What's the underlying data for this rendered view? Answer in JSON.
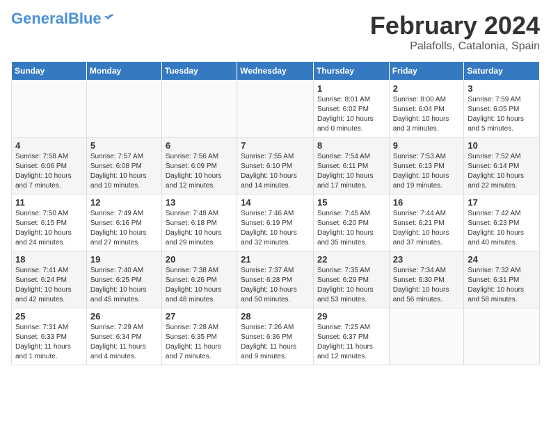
{
  "header": {
    "logo_general": "General",
    "logo_blue": "Blue",
    "month": "February 2024",
    "location": "Palafolls, Catalonia, Spain"
  },
  "weekdays": [
    "Sunday",
    "Monday",
    "Tuesday",
    "Wednesday",
    "Thursday",
    "Friday",
    "Saturday"
  ],
  "weeks": [
    [
      {
        "day": "",
        "info": ""
      },
      {
        "day": "",
        "info": ""
      },
      {
        "day": "",
        "info": ""
      },
      {
        "day": "",
        "info": ""
      },
      {
        "day": "1",
        "info": "Sunrise: 8:01 AM\nSunset: 6:02 PM\nDaylight: 10 hours and 0 minutes."
      },
      {
        "day": "2",
        "info": "Sunrise: 8:00 AM\nSunset: 6:04 PM\nDaylight: 10 hours and 3 minutes."
      },
      {
        "day": "3",
        "info": "Sunrise: 7:59 AM\nSunset: 6:05 PM\nDaylight: 10 hours and 5 minutes."
      }
    ],
    [
      {
        "day": "4",
        "info": "Sunrise: 7:58 AM\nSunset: 6:06 PM\nDaylight: 10 hours and 7 minutes."
      },
      {
        "day": "5",
        "info": "Sunrise: 7:57 AM\nSunset: 6:08 PM\nDaylight: 10 hours and 10 minutes."
      },
      {
        "day": "6",
        "info": "Sunrise: 7:56 AM\nSunset: 6:09 PM\nDaylight: 10 hours and 12 minutes."
      },
      {
        "day": "7",
        "info": "Sunrise: 7:55 AM\nSunset: 6:10 PM\nDaylight: 10 hours and 14 minutes."
      },
      {
        "day": "8",
        "info": "Sunrise: 7:54 AM\nSunset: 6:11 PM\nDaylight: 10 hours and 17 minutes."
      },
      {
        "day": "9",
        "info": "Sunrise: 7:53 AM\nSunset: 6:13 PM\nDaylight: 10 hours and 19 minutes."
      },
      {
        "day": "10",
        "info": "Sunrise: 7:52 AM\nSunset: 6:14 PM\nDaylight: 10 hours and 22 minutes."
      }
    ],
    [
      {
        "day": "11",
        "info": "Sunrise: 7:50 AM\nSunset: 6:15 PM\nDaylight: 10 hours and 24 minutes."
      },
      {
        "day": "12",
        "info": "Sunrise: 7:49 AM\nSunset: 6:16 PM\nDaylight: 10 hours and 27 minutes."
      },
      {
        "day": "13",
        "info": "Sunrise: 7:48 AM\nSunset: 6:18 PM\nDaylight: 10 hours and 29 minutes."
      },
      {
        "day": "14",
        "info": "Sunrise: 7:46 AM\nSunset: 6:19 PM\nDaylight: 10 hours and 32 minutes."
      },
      {
        "day": "15",
        "info": "Sunrise: 7:45 AM\nSunset: 6:20 PM\nDaylight: 10 hours and 35 minutes."
      },
      {
        "day": "16",
        "info": "Sunrise: 7:44 AM\nSunset: 6:21 PM\nDaylight: 10 hours and 37 minutes."
      },
      {
        "day": "17",
        "info": "Sunrise: 7:42 AM\nSunset: 6:23 PM\nDaylight: 10 hours and 40 minutes."
      }
    ],
    [
      {
        "day": "18",
        "info": "Sunrise: 7:41 AM\nSunset: 6:24 PM\nDaylight: 10 hours and 42 minutes."
      },
      {
        "day": "19",
        "info": "Sunrise: 7:40 AM\nSunset: 6:25 PM\nDaylight: 10 hours and 45 minutes."
      },
      {
        "day": "20",
        "info": "Sunrise: 7:38 AM\nSunset: 6:26 PM\nDaylight: 10 hours and 48 minutes."
      },
      {
        "day": "21",
        "info": "Sunrise: 7:37 AM\nSunset: 6:28 PM\nDaylight: 10 hours and 50 minutes."
      },
      {
        "day": "22",
        "info": "Sunrise: 7:35 AM\nSunset: 6:29 PM\nDaylight: 10 hours and 53 minutes."
      },
      {
        "day": "23",
        "info": "Sunrise: 7:34 AM\nSunset: 6:30 PM\nDaylight: 10 hours and 56 minutes."
      },
      {
        "day": "24",
        "info": "Sunrise: 7:32 AM\nSunset: 6:31 PM\nDaylight: 10 hours and 58 minutes."
      }
    ],
    [
      {
        "day": "25",
        "info": "Sunrise: 7:31 AM\nSunset: 6:33 PM\nDaylight: 11 hours and 1 minute."
      },
      {
        "day": "26",
        "info": "Sunrise: 7:29 AM\nSunset: 6:34 PM\nDaylight: 11 hours and 4 minutes."
      },
      {
        "day": "27",
        "info": "Sunrise: 7:28 AM\nSunset: 6:35 PM\nDaylight: 11 hours and 7 minutes."
      },
      {
        "day": "28",
        "info": "Sunrise: 7:26 AM\nSunset: 6:36 PM\nDaylight: 11 hours and 9 minutes."
      },
      {
        "day": "29",
        "info": "Sunrise: 7:25 AM\nSunset: 6:37 PM\nDaylight: 11 hours and 12 minutes."
      },
      {
        "day": "",
        "info": ""
      },
      {
        "day": "",
        "info": ""
      }
    ]
  ]
}
